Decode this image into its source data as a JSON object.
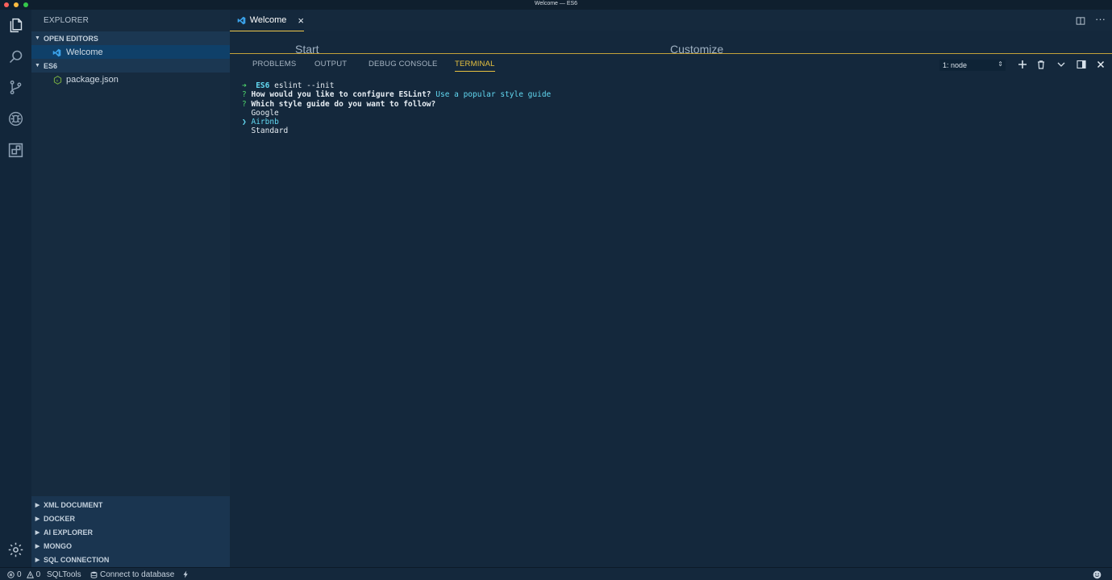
{
  "window": {
    "title": "Welcome — ES6"
  },
  "colors": {
    "background": "#14283c",
    "accent": "#e7c240",
    "terminal_green": "#4fd76b",
    "terminal_cyan": "#62d8f1"
  },
  "activity_bar": {
    "items": [
      {
        "name": "files-icon"
      },
      {
        "name": "search-icon"
      },
      {
        "name": "source-control-icon"
      },
      {
        "name": "debug-icon"
      },
      {
        "name": "extensions-icon"
      }
    ],
    "settings": "gear-icon"
  },
  "sidebar": {
    "title": "EXPLORER",
    "open_editors": {
      "label": "OPEN EDITORS",
      "items": [
        {
          "label": "Welcome"
        }
      ]
    },
    "folder": {
      "label": "ES6",
      "items": [
        {
          "label": "package.json"
        }
      ]
    },
    "bottom_sections": [
      "XML DOCUMENT",
      "DOCKER",
      "AI EXPLORER",
      "MONGO",
      "SQL CONNECTION"
    ]
  },
  "editor": {
    "tabs": [
      {
        "label": "Welcome",
        "close": "×"
      }
    ],
    "welcome": {
      "start": "Start",
      "customize": "Customize"
    }
  },
  "panel": {
    "tabs": [
      "PROBLEMS",
      "OUTPUT",
      "DEBUG CONSOLE",
      "TERMINAL"
    ],
    "active_tab": "TERMINAL",
    "terminal_select": "1: node",
    "terminal": {
      "l1_arrow": "➜",
      "l1_dir": "ES6",
      "l1_cmd": "eslint --init",
      "l2_q": "?",
      "l2_text": "How would you like to configure ESLint?",
      "l2_answer": "Use a popular style guide",
      "l3_q": "?",
      "l3_text": "Which style guide do you want to follow?",
      "options": [
        {
          "label": "Google",
          "selected": false
        },
        {
          "label": "Airbnb",
          "selected": true
        },
        {
          "label": "Standard",
          "selected": false
        }
      ],
      "pointer": "❯"
    }
  },
  "status_bar": {
    "errors": "0",
    "warnings": "0",
    "sqltools": "SQLTools",
    "connect": "Connect to database"
  }
}
